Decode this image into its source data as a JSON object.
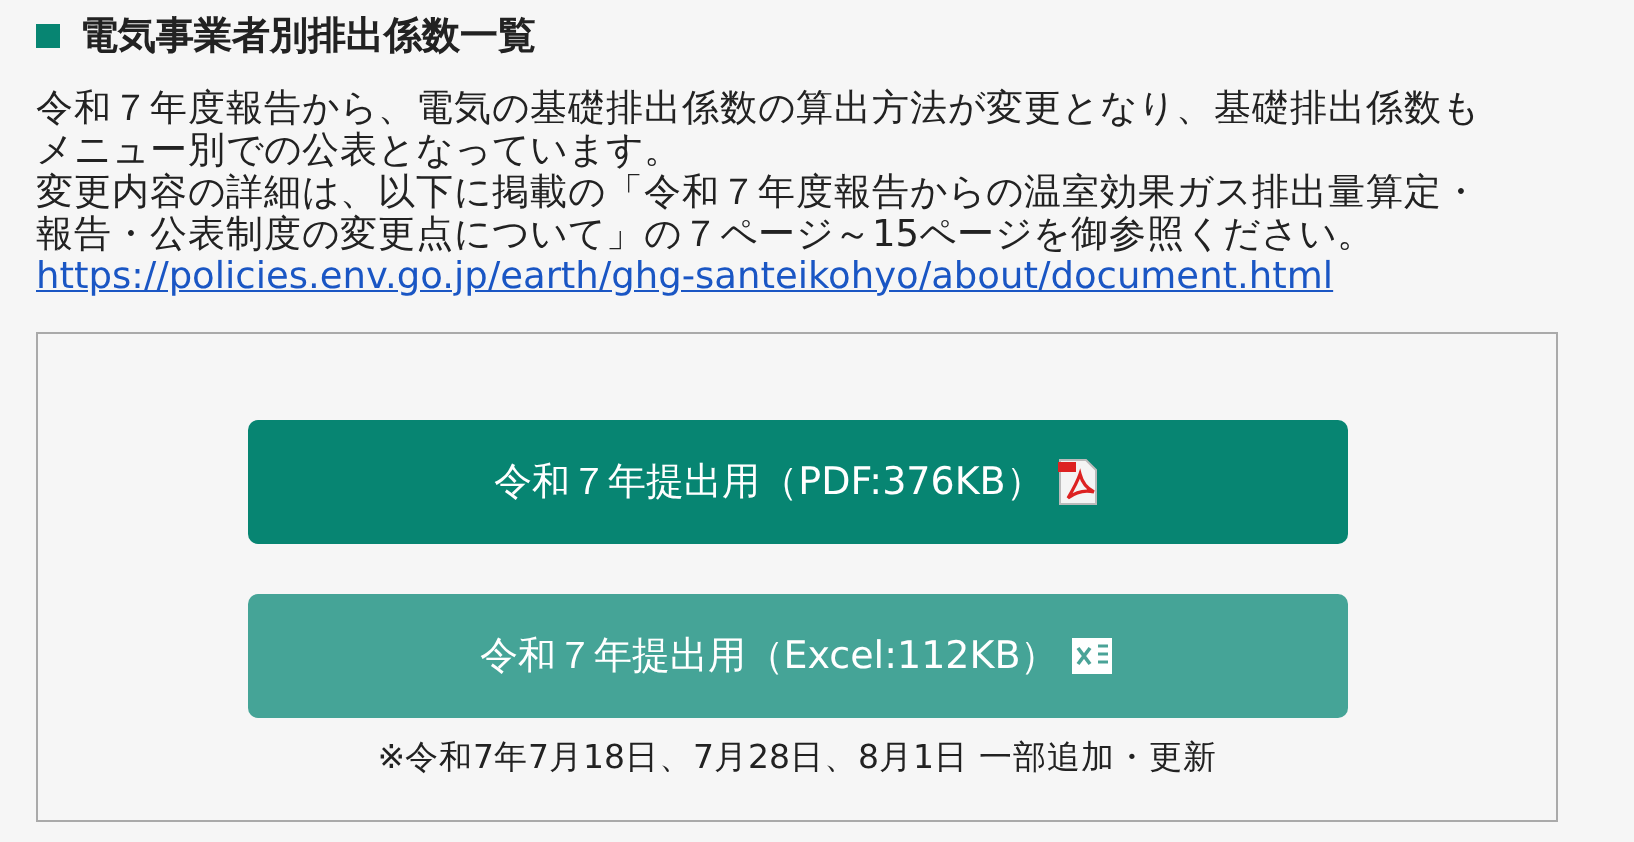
{
  "heading": "電気事業者別排出係数一覧",
  "paragraphs": [
    {
      "lines": [
        "令和７年度報告から、電気の基礎排出係数の算出方法が変更となり、基礎排出係数も",
        "メニュー別での公表となっています。"
      ]
    },
    {
      "lines": [
        "変更内容の詳細は、以下に掲載の「令和７年度報告からの温室効果ガス排出量算定・",
        "報告・公表制度の変更点について」の７ページ～15ページを御参照ください。"
      ]
    }
  ],
  "link": "https://policies.env.go.jp/earth/ghg-santeikohyo/about/document.html",
  "downloads": [
    {
      "kind": "pdf",
      "label": "令和７年提出用（PDF:376KB）"
    },
    {
      "kind": "excel",
      "label": "令和７年提出用（Excel:112KB）"
    }
  ],
  "note": "※令和7年7月18日、7月28日、8月1日 一部追加・更新"
}
